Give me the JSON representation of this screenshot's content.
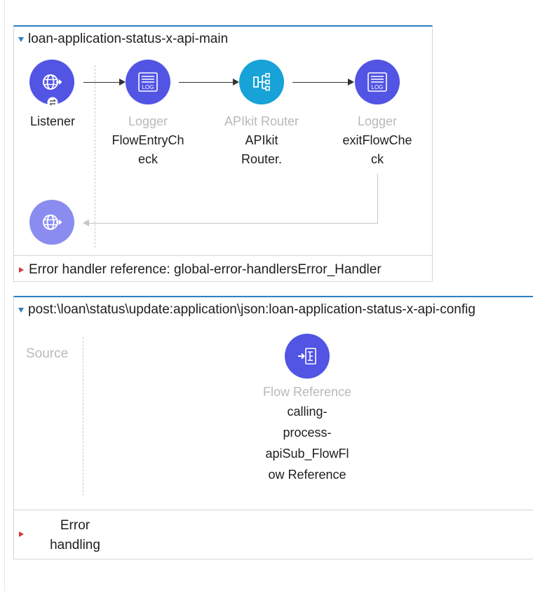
{
  "flow1": {
    "name": "loan-application-status-x-api-main",
    "components": [
      {
        "type": "",
        "label": "Listener",
        "icon": "globe-icon"
      },
      {
        "type": "Logger",
        "label_lines": [
          "FlowEntryCh",
          "eck"
        ],
        "icon": "logger-icon"
      },
      {
        "type": "APIkit Router",
        "label_lines": [
          "APIkit",
          "Router."
        ],
        "icon": "apikit-router-icon"
      },
      {
        "type": "Logger",
        "label_lines": [
          "exitFlowChe",
          "ck"
        ],
        "icon": "logger-icon"
      }
    ],
    "response_icon": "globe-icon",
    "error_handler_reference": "Error handler reference: global-error-handlersError_Handler"
  },
  "flow2": {
    "name": "post:\\loan\\status\\update:application\\json:loan-application-status-x-api-config",
    "source_label": "Source",
    "component": {
      "type": "Flow Reference",
      "label_lines": [
        "calling-",
        "process-",
        "apiSub_FlowFl",
        "ow Reference"
      ],
      "icon": "flow-reference-icon"
    },
    "error_handling_lines": [
      "Error",
      "handling"
    ]
  },
  "colors": {
    "accent": "#2f7fc1",
    "component": "#5254e4",
    "router": "#17a2d8",
    "error_triangle": "#d63a3a"
  }
}
